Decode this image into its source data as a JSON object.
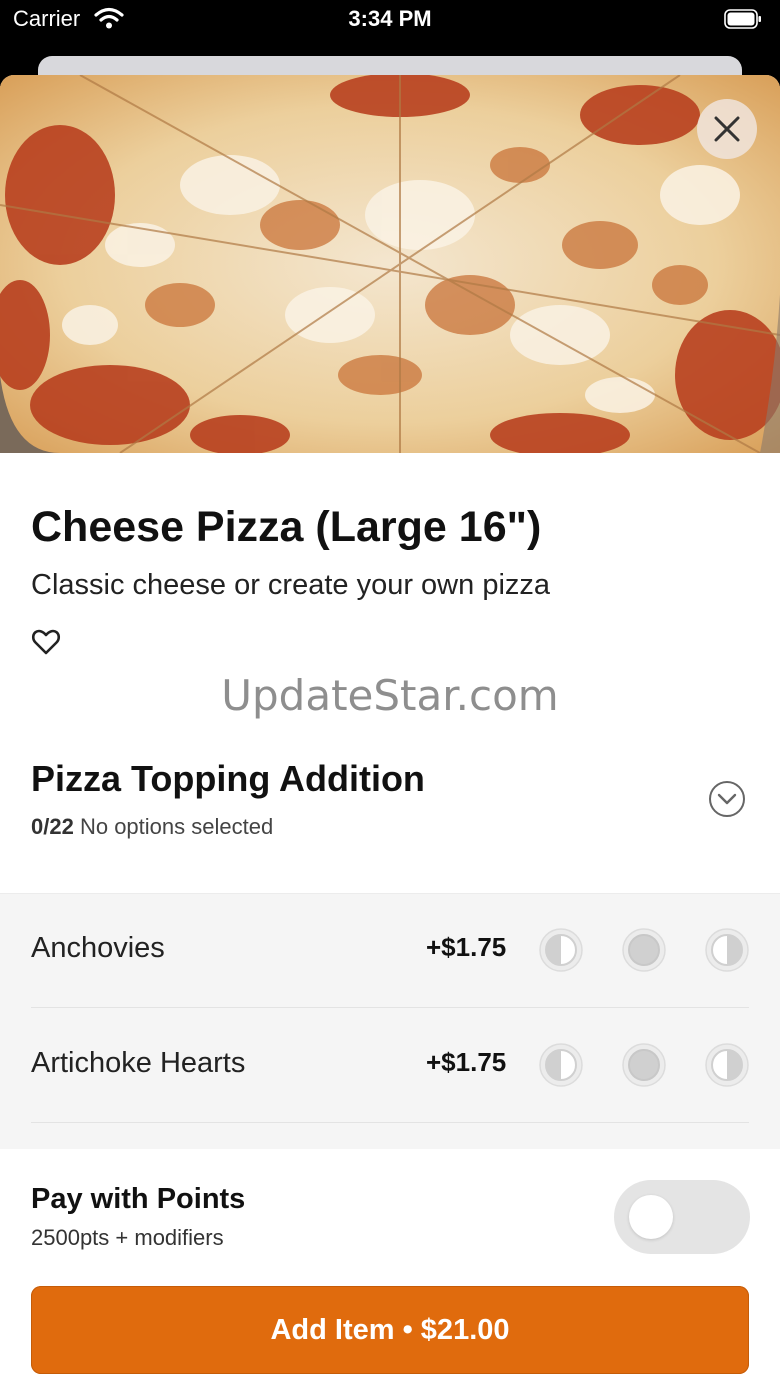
{
  "status_bar": {
    "carrier": "Carrier",
    "time": "3:34 PM"
  },
  "item": {
    "title": "Cheese Pizza (Large 16\")",
    "description": "Classic cheese or create your own pizza"
  },
  "watermark": "UpdateStar.com",
  "modifier_group": {
    "title": "Pizza Topping Addition",
    "selected_count": "0/22",
    "status": "No options selected",
    "options": [
      {
        "name": "Anchovies",
        "price": "+$1.75"
      },
      {
        "name": "Artichoke Hearts",
        "price": "+$1.75"
      }
    ]
  },
  "points": {
    "title": "Pay with Points",
    "subtitle": "2500pts + modifiers",
    "enabled": false
  },
  "add_button": {
    "label": "Add Item • $21.00"
  },
  "colors": {
    "accent": "#e06b0d",
    "toggle_off": "#e4e4e4"
  },
  "icons": [
    "wifi-icon",
    "battery-icon",
    "close-icon",
    "heart-icon",
    "chevron-down-icon",
    "left-half-icon",
    "whole-icon",
    "right-half-icon"
  ]
}
